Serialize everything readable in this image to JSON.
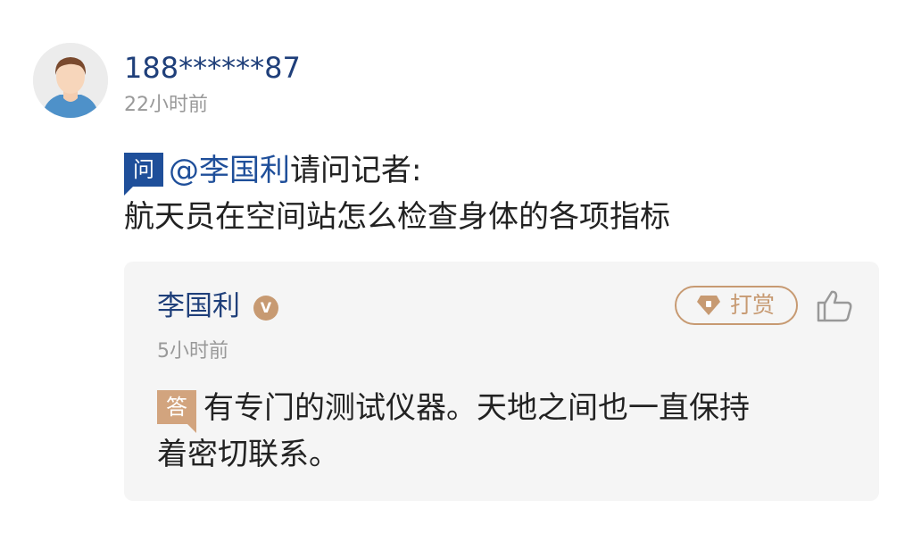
{
  "comment": {
    "username": "188******87",
    "time": "22小时前",
    "question_badge": "问",
    "mention": "@李国利",
    "question_prefix": "请问记者:",
    "question_text": "航天员在空间站怎么检查身体的各项指标"
  },
  "reply": {
    "author": "李国利",
    "verified_badge": "V",
    "reward_label": "打赏",
    "time": "5小时前",
    "answer_badge": "答",
    "answer_line1": "有专门的测试仪器。天地之间也一直保持",
    "answer_line2": "着密切联系。"
  },
  "icons": {
    "avatar": "user-avatar-icon",
    "reward": "diamond-icon",
    "like": "thumbs-up-icon"
  },
  "colors": {
    "username": "#1f3f7a",
    "question_badge": "#1f4f9a",
    "answer_badge": "#d2a47e",
    "accent_gold": "#c79a72",
    "reply_background": "#f5f5f5",
    "muted_text": "#999999"
  }
}
